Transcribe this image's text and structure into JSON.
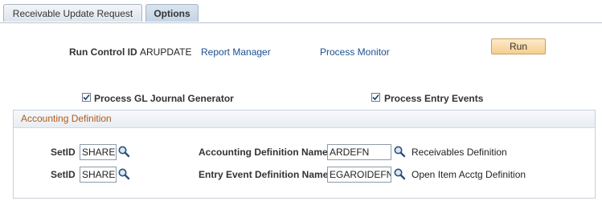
{
  "tabs": [
    {
      "label": "Receivable Update Request",
      "active": false
    },
    {
      "label": "Options",
      "active": true
    }
  ],
  "run_control": {
    "label": "Run Control ID",
    "value": "ARUPDATE",
    "report_manager_link": "Report Manager",
    "process_monitor_link": "Process Monitor",
    "run_button": "Run"
  },
  "options": {
    "process_gl_journal_generator": {
      "label": "Process GL Journal Generator",
      "checked": true
    },
    "process_entry_events": {
      "label": "Process Entry Events",
      "checked": true
    }
  },
  "accounting_definition": {
    "title": "Accounting Definition",
    "rows": [
      {
        "setid_label": "SetID",
        "setid_value": "SHARE",
        "name_label": "Accounting Definition Name",
        "name_value": "ARDEFN",
        "description": "Receivables Definition"
      },
      {
        "setid_label": "SetID",
        "setid_value": "SHARE",
        "name_label": "Entry Event Definition Name",
        "name_value": "EGAROIDEFN",
        "description": "Open Item Acctg Definition"
      }
    ]
  },
  "colors": {
    "link": "#1a4f8f",
    "group_title": "#b15a1a",
    "run_button": "#f6cf8f"
  },
  "icons": {
    "checkbox_checked": "check-mark",
    "lookup": "magnifier"
  }
}
